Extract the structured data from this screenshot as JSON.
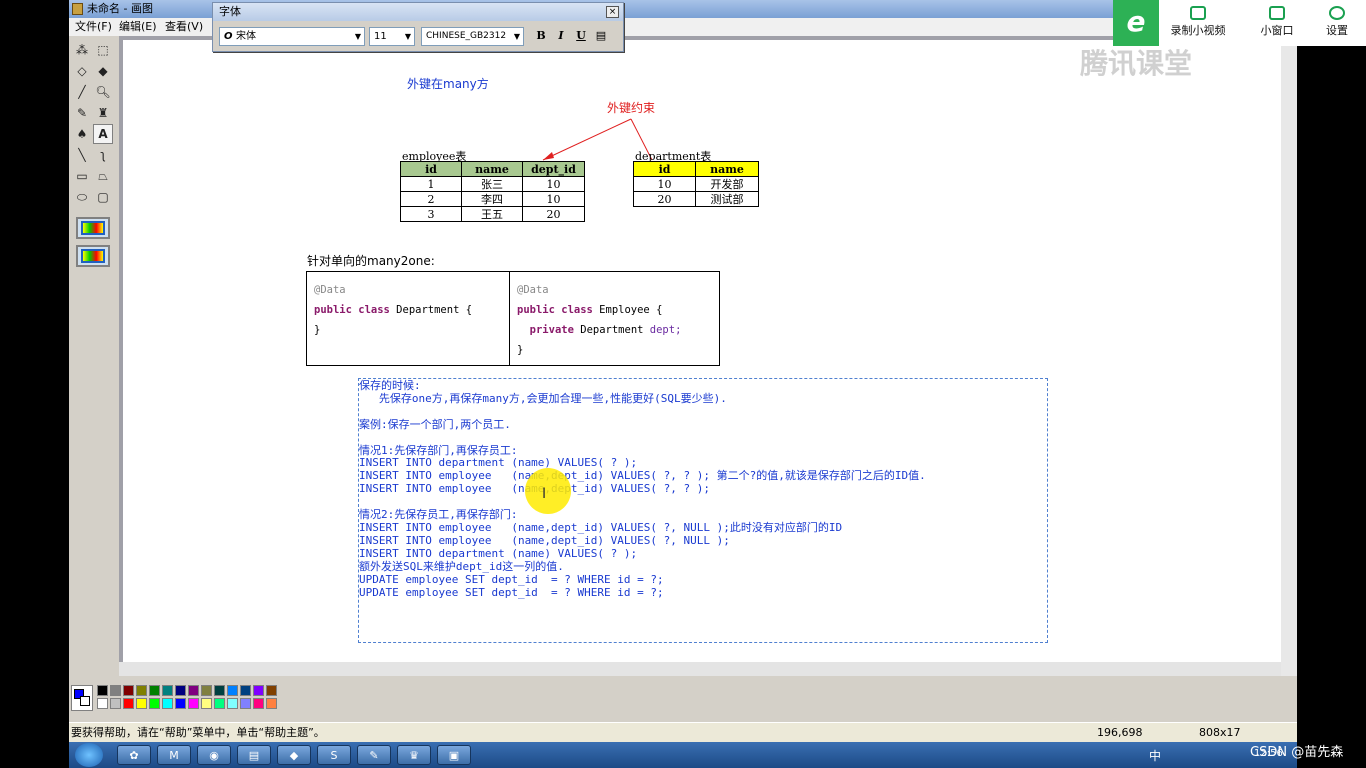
{
  "window": {
    "title": "未命名 - 画图"
  },
  "menu": [
    "文件(F)",
    "编辑(E)",
    "查看(V)"
  ],
  "font_dialog": {
    "title": "字体",
    "font_name": "宋体",
    "font_size": "11",
    "script": "CHINESE_GB2312",
    "bold": "B",
    "italic": "I",
    "underline": "U"
  },
  "drawing": {
    "fk_many_label": "外键在many方",
    "fk_constraint_label": "外键约束",
    "employee_caption": "employee表",
    "employee_table": {
      "headers": [
        "id",
        "name",
        "dept_id"
      ],
      "rows": [
        [
          "1",
          "张三",
          "10"
        ],
        [
          "2",
          "李四",
          "10"
        ],
        [
          "3",
          "王五",
          "20"
        ]
      ]
    },
    "department_caption": "department表",
    "department_table": {
      "headers": [
        "id",
        "name"
      ],
      "rows": [
        [
          "10",
          "开发部"
        ],
        [
          "20",
          "测试部"
        ]
      ]
    },
    "many2one_label": "针对单向的many2one:",
    "department_code": {
      "annotation": "@Data",
      "l1_kw": "public class",
      "l1_rest": " Department {",
      "l3": "}"
    },
    "employee_code": {
      "annotation": "@Data",
      "l1_kw": "public class",
      "l1_rest": " Employee {",
      "l2_kw": "private",
      "l2_type": " Department ",
      "l2_field": "dept;",
      "l3": "}"
    },
    "text_lines": [
      "保存的时候:",
      "   先保存one方,再保存many方,会更加合理一些,性能更好(SQL要少些).",
      "",
      "案例:保存一个部门,两个员工.",
      "",
      "情况1:先保存部门,再保存员工:",
      "INSERT INTO department (name) VALUES( ? );",
      "INSERT INTO employee   (name,dept_id) VALUES( ?, ? ); 第二个?的值,就该是保存部门之后的ID值.",
      "INSERT INTO employee   (name,dept_id) VALUES( ?, ? );",
      "",
      "情况2:先保存员工,再保存部门:",
      "INSERT INTO employee   (name,dept_id) VALUES( ?, NULL );此时没有对应部门的ID",
      "INSERT INTO employee   (name,dept_id) VALUES( ?, NULL );",
      "INSERT INTO department (name) VALUES( ? );",
      "额外发送SQL来维护dept_id这一列的值.",
      "UPDATE employee SET dept_id  = ? WHERE id = ?;",
      "UPDATE employee SET dept_id  = ? WHERE id = ?;"
    ]
  },
  "status": {
    "help": "要获得帮助，请在“帮助”菜单中，单击“帮助主题”。",
    "coords": "196,698",
    "size": "808x17"
  },
  "palette_colors": [
    "#000000",
    "#808080",
    "#800000",
    "#808000",
    "#008000",
    "#008080",
    "#000080",
    "#800080",
    "#808040",
    "#004040",
    "#0080ff",
    "#004080",
    "#8000ff",
    "#804000",
    "#ffffff",
    "#c0c0c0",
    "#ff0000",
    "#ffff00",
    "#00ff00",
    "#00ffff",
    "#0000ff",
    "#ff00ff",
    "#ffff80",
    "#00ff80",
    "#80ffff",
    "#8080ff",
    "#ff0080",
    "#ff8040"
  ],
  "tencent": {
    "record_label": "录制小视频",
    "window_label": "小窗口",
    "settings_label": "设置",
    "watermark": "腾讯课堂"
  },
  "tray": {
    "ime": "中",
    "time": "12:56"
  },
  "csdn_watermark": "CSDN @苗先森"
}
